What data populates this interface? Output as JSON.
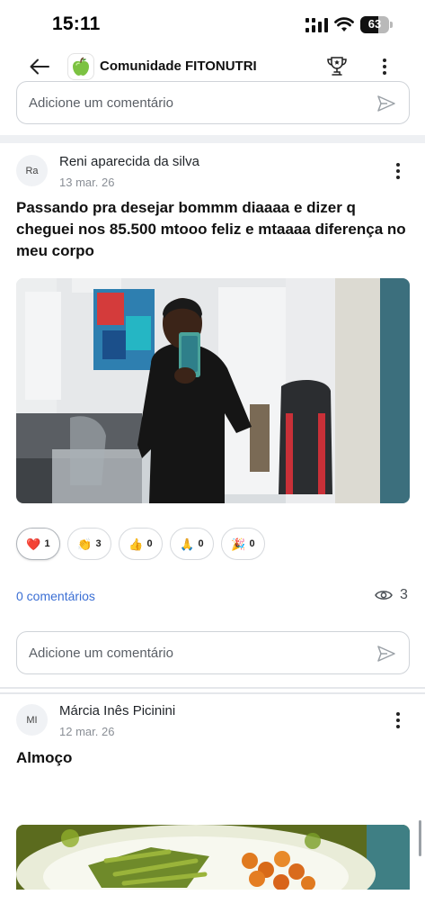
{
  "status_bar": {
    "time": "15:11",
    "battery": "63",
    "battery_level": 0.63
  },
  "header": {
    "title": "Comunidade FITONUTRI",
    "logo_icon": "green-apple",
    "accent": "#3b6fd4"
  },
  "top_comment_box": {
    "placeholder": "Adicione um comentário"
  },
  "post1": {
    "avatar_initials": "Ra",
    "author": "Reni aparecida da silva",
    "date": "13 mar. 26",
    "text": "Passando pra desejar bommm diaaaa e dizer q cheguei nos 85.500 mtooo feliz e mtaaaa diferença no meu corpo",
    "reactions": [
      {
        "emoji": "❤️",
        "count": "1",
        "active": true
      },
      {
        "emoji": "👏",
        "count": "3",
        "active": false
      },
      {
        "emoji": "👍",
        "count": "0",
        "active": false
      },
      {
        "emoji": "🙏",
        "count": "0",
        "active": false
      },
      {
        "emoji": "🎉",
        "count": "0",
        "active": false
      }
    ],
    "comments_label": "0 comentários",
    "views": "3",
    "comment_placeholder": "Adicione um comentário"
  },
  "post2": {
    "avatar_initials": "MI",
    "author": "Márcia Inês Picinini",
    "date": "12 mar. 26",
    "text": "Almoço"
  }
}
